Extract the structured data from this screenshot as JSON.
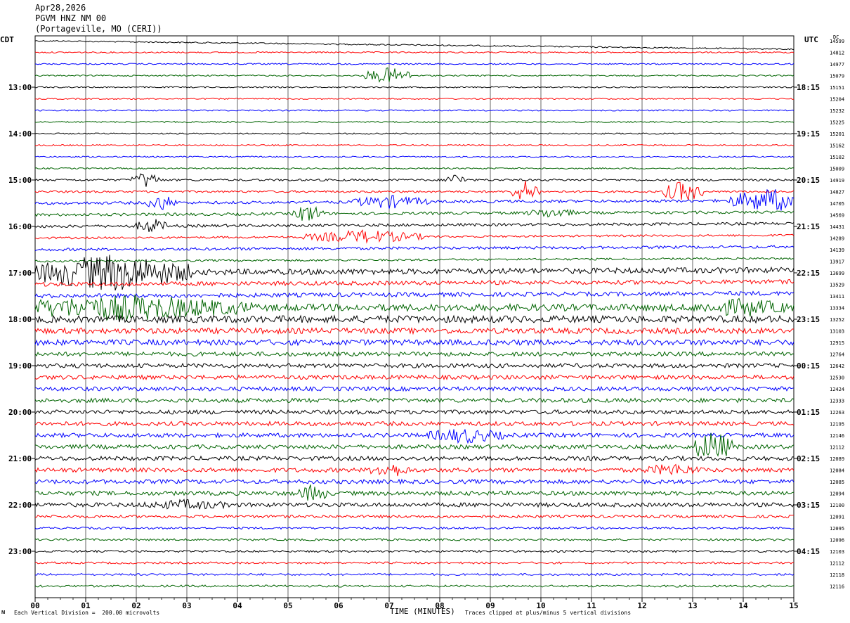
{
  "header": {
    "date": "Apr28,2026",
    "station": "PGVM HNZ NM 00",
    "location": "(Portageville, MO (CERI))"
  },
  "left_label": "CDT",
  "right_label": "UTC",
  "dc_label": "DC",
  "footer": {
    "scale_note": "Each Vertical Division =  200.00 microvolts",
    "xlabel": "TIME (MINUTES)",
    "clip_note": "Traces clipped at plus/minus 5 vertical divisions",
    "corner_mark": "ᴍ"
  },
  "colors": {
    "trace_cycle": [
      "#000000",
      "#ff0000",
      "#0000ff",
      "#006400"
    ],
    "grid": "#000000"
  },
  "chart_data": {
    "type": "line",
    "title": "",
    "xlabel": "TIME (MINUTES)",
    "xlim": [
      0,
      15
    ],
    "x_ticks": [
      "00",
      "01",
      "02",
      "03",
      "04",
      "05",
      "06",
      "07",
      "08",
      "09",
      "10",
      "11",
      "12",
      "13",
      "14",
      "15"
    ],
    "grid": true,
    "trace_count": 48,
    "left_time_labels": [
      {
        "row": 4,
        "text": "13:00"
      },
      {
        "row": 8,
        "text": "14:00"
      },
      {
        "row": 12,
        "text": "15:00"
      },
      {
        "row": 16,
        "text": "16:00"
      },
      {
        "row": 20,
        "text": "17:00"
      },
      {
        "row": 24,
        "text": "18:00"
      },
      {
        "row": 28,
        "text": "19:00"
      },
      {
        "row": 32,
        "text": "20:00"
      },
      {
        "row": 36,
        "text": "21:00"
      },
      {
        "row": 40,
        "text": "22:00"
      },
      {
        "row": 44,
        "text": "23:00"
      }
    ],
    "right_time_labels": [
      {
        "row": 4,
        "text": "18:15"
      },
      {
        "row": 8,
        "text": "19:15"
      },
      {
        "row": 12,
        "text": "20:15"
      },
      {
        "row": 16,
        "text": "21:15"
      },
      {
        "row": 20,
        "text": "22:15"
      },
      {
        "row": 24,
        "text": "23:15"
      },
      {
        "row": 28,
        "text": "00:15"
      },
      {
        "row": 32,
        "text": "01:15"
      },
      {
        "row": 36,
        "text": "02:15"
      },
      {
        "row": 40,
        "text": "03:15"
      },
      {
        "row": 44,
        "text": "04:15"
      }
    ],
    "dc_offsets": [
      "14599",
      "14812",
      "14977",
      "15079",
      "15151",
      "15204",
      "15232",
      "15225",
      "15201",
      "15162",
      "15102",
      "15009",
      "14919",
      "14827",
      "14705",
      "14569",
      "14431",
      "14289",
      "14139",
      "13917",
      "13699",
      "13529",
      "13411",
      "13334",
      "13252",
      "13103",
      "12915",
      "12764",
      "12642",
      "12530",
      "12424",
      "12333",
      "12263",
      "12195",
      "12146",
      "12112",
      "12089",
      "12084",
      "12085",
      "12094",
      "12100",
      "12091",
      "12095",
      "12096",
      "12103",
      "12112",
      "12118",
      "12116"
    ],
    "noise_levels": [
      1,
      1,
      1,
      1,
      1,
      1,
      1,
      1,
      1,
      1,
      1,
      1,
      1.5,
      1.5,
      2,
      2,
      2,
      1.5,
      2,
      1.5,
      4,
      3,
      3,
      5,
      5,
      4,
      4,
      3,
      3,
      3,
      3,
      3,
      3,
      3,
      3,
      3,
      3,
      3,
      3,
      3,
      3,
      2,
      1.5,
      1.5,
      1.5,
      1.5,
      1.5,
      1.5
    ],
    "events": [
      {
        "row": 3,
        "minute": 7.0,
        "amp": 12,
        "dur": 0.5
      },
      {
        "row": 12,
        "minute": 2.2,
        "amp": 12,
        "dur": 0.3
      },
      {
        "row": 12,
        "minute": 8.3,
        "amp": 10,
        "dur": 0.2
      },
      {
        "row": 13,
        "minute": 9.7,
        "amp": 16,
        "dur": 0.3
      },
      {
        "row": 13,
        "minute": 12.8,
        "amp": 16,
        "dur": 0.4
      },
      {
        "row": 14,
        "minute": 2.5,
        "amp": 12,
        "dur": 0.3
      },
      {
        "row": 14,
        "minute": 7.0,
        "amp": 10,
        "dur": 0.8
      },
      {
        "row": 14,
        "minute": 14.5,
        "amp": 18,
        "dur": 0.8
      },
      {
        "row": 15,
        "minute": 5.4,
        "amp": 14,
        "dur": 0.3
      },
      {
        "row": 15,
        "minute": 10.2,
        "amp": 8,
        "dur": 0.5
      },
      {
        "row": 16,
        "minute": 2.3,
        "amp": 12,
        "dur": 0.3
      },
      {
        "row": 17,
        "minute": 6.5,
        "amp": 10,
        "dur": 1.2
      },
      {
        "row": 20,
        "minute": 1.5,
        "amp": 28,
        "dur": 1.6
      },
      {
        "row": 23,
        "minute": 1.8,
        "amp": 20,
        "dur": 2.5
      },
      {
        "row": 23,
        "minute": 14.0,
        "amp": 14,
        "dur": 1.0
      },
      {
        "row": 34,
        "minute": 8.5,
        "amp": 12,
        "dur": 0.8
      },
      {
        "row": 35,
        "minute": 13.4,
        "amp": 24,
        "dur": 0.4
      },
      {
        "row": 37,
        "minute": 7.0,
        "amp": 12,
        "dur": 0.4
      },
      {
        "row": 37,
        "minute": 12.6,
        "amp": 10,
        "dur": 0.6
      },
      {
        "row": 39,
        "minute": 5.5,
        "amp": 14,
        "dur": 0.3
      },
      {
        "row": 40,
        "minute": 3.0,
        "amp": 8,
        "dur": 1.0
      }
    ]
  }
}
